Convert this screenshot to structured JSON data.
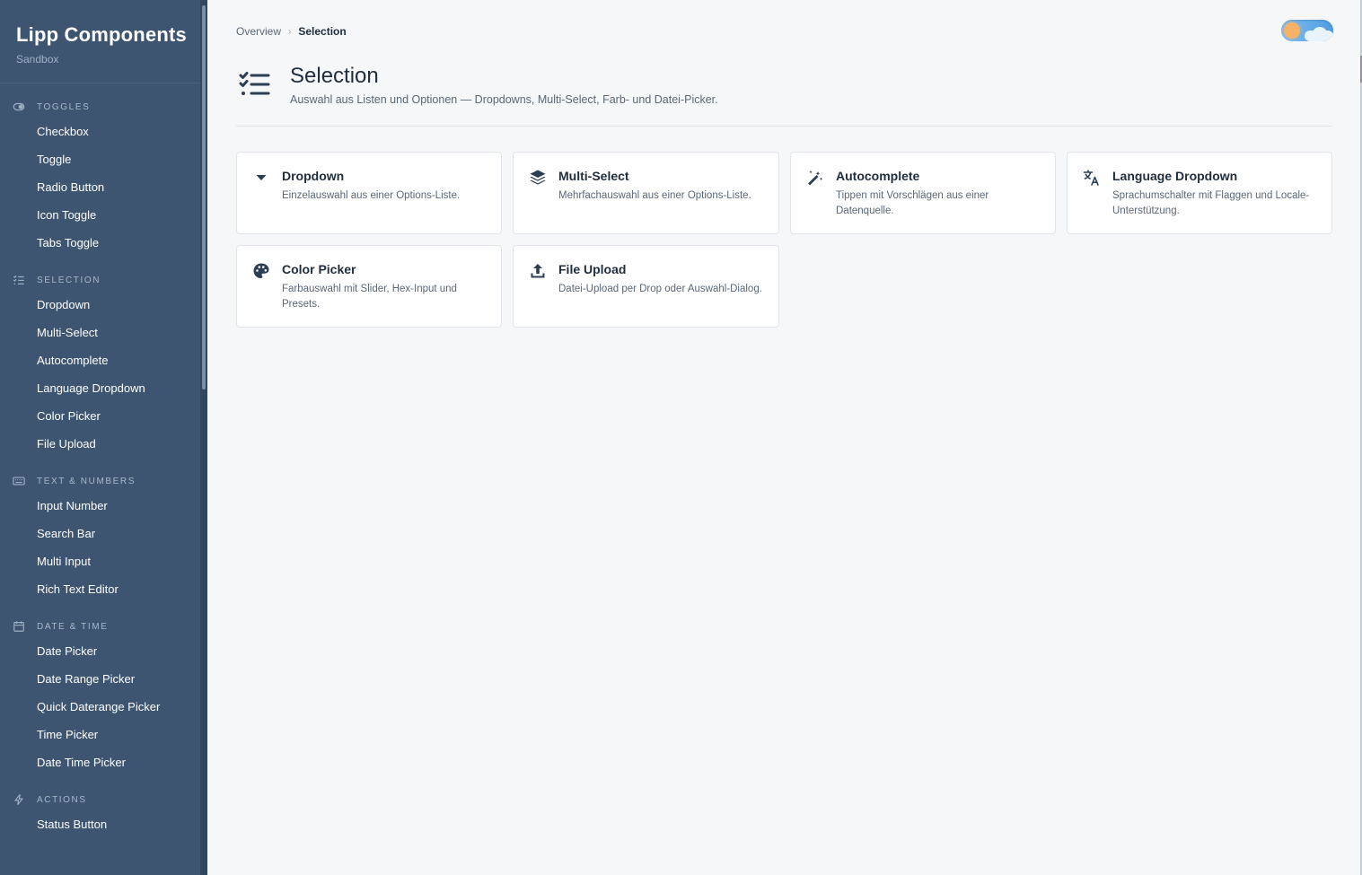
{
  "sidebar": {
    "brand_title": "Lipp Components",
    "brand_subtitle": "Sandbox",
    "sections": [
      {
        "title": "Toggles",
        "icon": "toggle-icon",
        "items": [
          "Checkbox",
          "Toggle",
          "Radio Button",
          "Icon Toggle",
          "Tabs Toggle"
        ]
      },
      {
        "title": "Selection",
        "icon": "list-check-icon",
        "items": [
          "Dropdown",
          "Multi-Select",
          "Autocomplete",
          "Language Dropdown",
          "Color Picker",
          "File Upload"
        ]
      },
      {
        "title": "Text & Numbers",
        "icon": "keyboard-icon",
        "items": [
          "Input Number",
          "Search Bar",
          "Multi Input",
          "Rich Text Editor"
        ]
      },
      {
        "title": "Date & Time",
        "icon": "calendar-icon",
        "items": [
          "Date Picker",
          "Date Range Picker",
          "Quick Daterange Picker",
          "Time Picker",
          "Date Time Picker"
        ]
      },
      {
        "title": "Actions",
        "icon": "bolt-icon",
        "items": [
          "Status Button"
        ]
      }
    ]
  },
  "breadcrumb": {
    "parent": "Overview",
    "separator": "›",
    "current": "Selection"
  },
  "header": {
    "icon": "list-check-icon",
    "title": "Selection",
    "subtitle": "Auswahl aus Listen und Optionen — Dropdowns, Multi-Select, Farb- und Datei-Picker."
  },
  "theme_toggle": {
    "mode": "light",
    "colors": {
      "track": "#5fa9e8",
      "sun": "#f7b267",
      "cloud": "#e8f3fc"
    }
  },
  "cards": [
    {
      "icon": "caret-down-icon",
      "title": "Dropdown",
      "description": "Einzelauswahl aus einer Options-Liste."
    },
    {
      "icon": "layers-icon",
      "title": "Multi-Select",
      "description": "Mehrfachauswahl aus einer Options-Liste."
    },
    {
      "icon": "magic-wand-icon",
      "title": "Autocomplete",
      "description": "Tippen mit Vorschlägen aus einer Datenquelle."
    },
    {
      "icon": "translate-icon",
      "title": "Language Dropdown",
      "description": "Sprachumschalter mit Flaggen und Locale-Unterstützung."
    },
    {
      "icon": "palette-icon",
      "title": "Color Picker",
      "description": "Farbauswahl mit Slider, Hex-Input und Presets."
    },
    {
      "icon": "upload-icon",
      "title": "File Upload",
      "description": "Datei-Upload per Drop oder Auswahl-Dialog."
    }
  ],
  "colors": {
    "sidebar_bg": "#3d5570",
    "main_bg": "#f6f7f9",
    "text_dark": "#1f2d3d",
    "text_muted": "#5b6776"
  }
}
